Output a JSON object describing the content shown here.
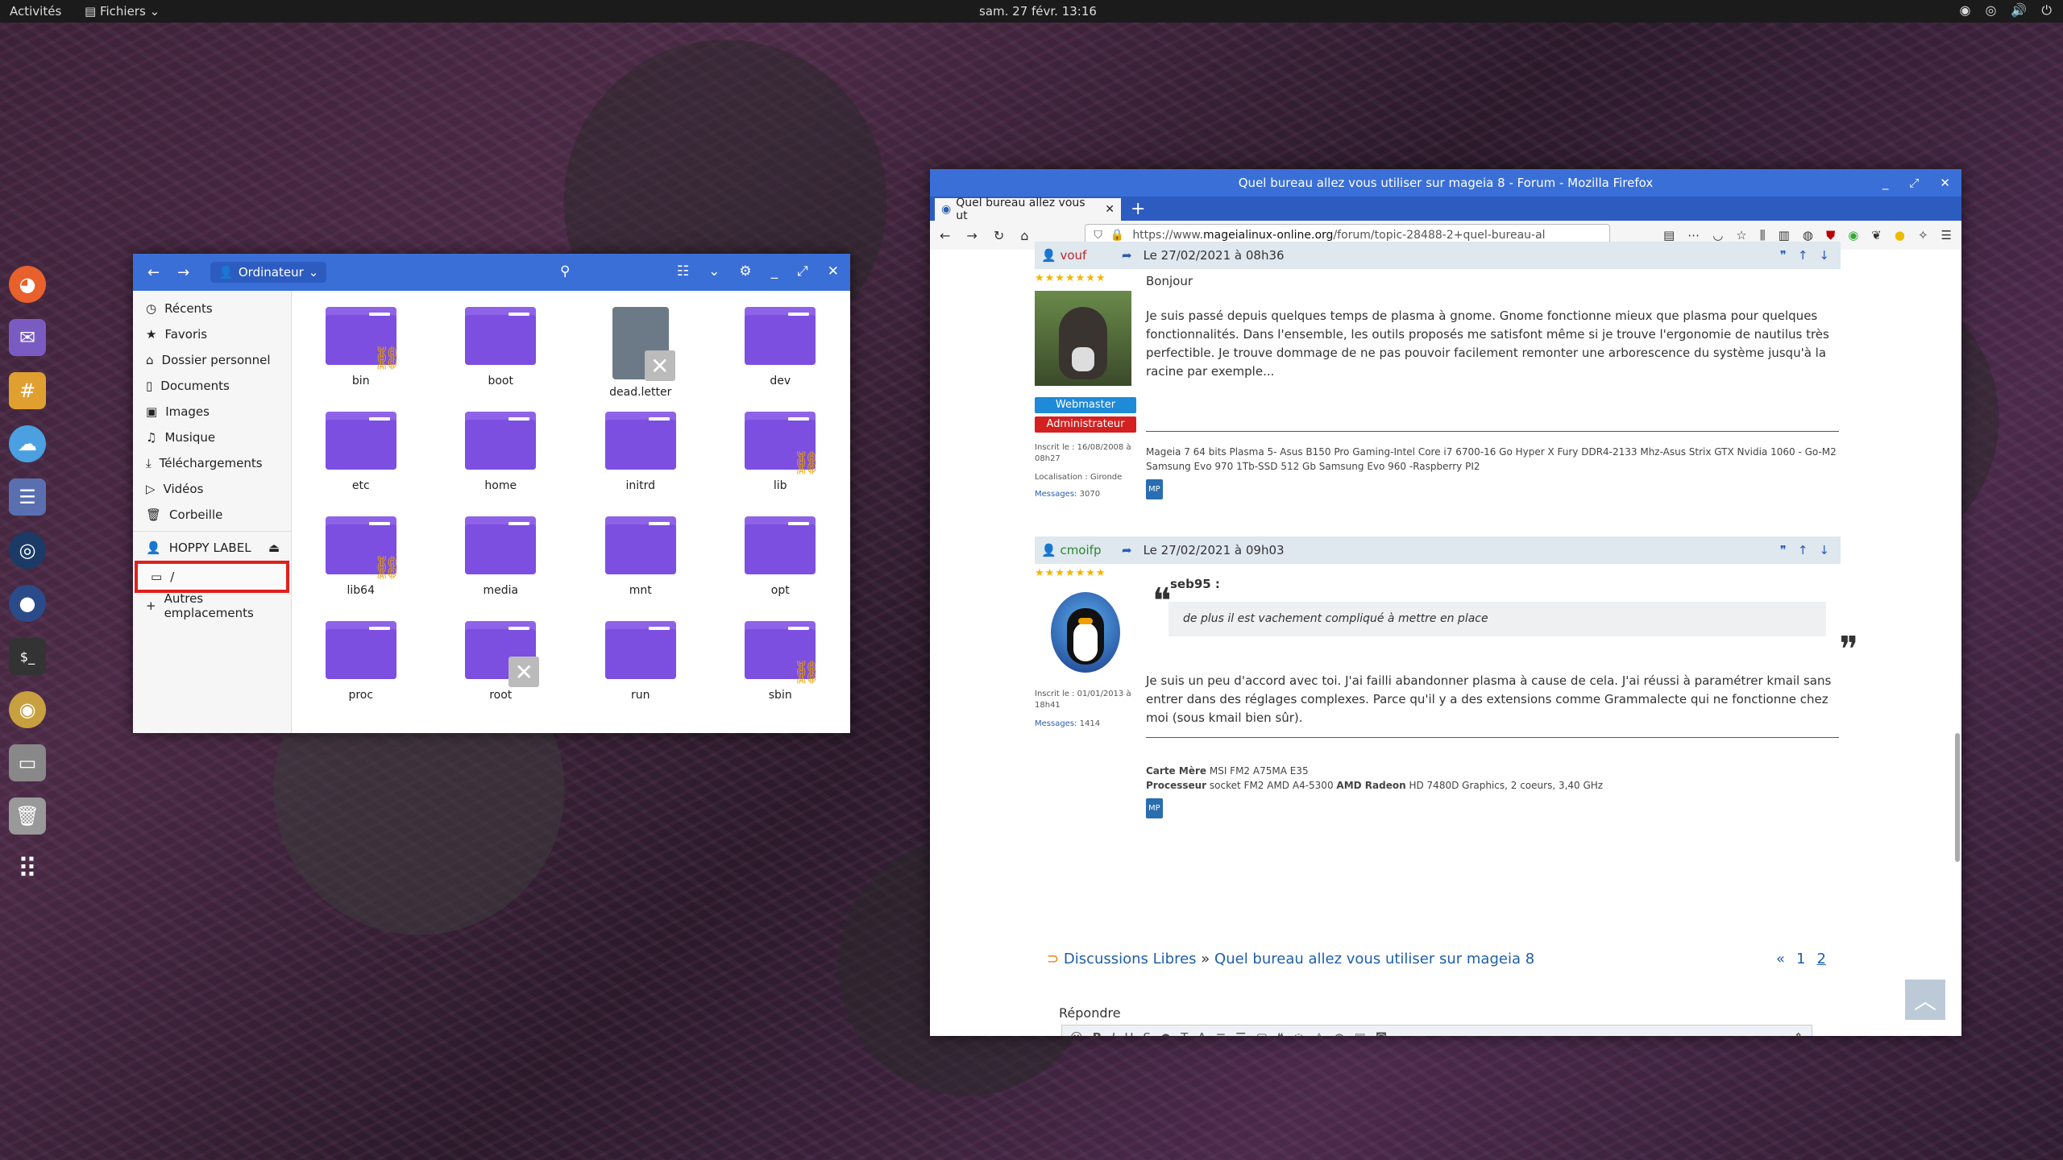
{
  "topbar": {
    "activities": "Activités",
    "app": "Fichiers",
    "clock": "sam. 27 févr.  13:16"
  },
  "files": {
    "location": "Ordinateur",
    "sidebar": [
      "Récents",
      "Favoris",
      "Dossier personnel",
      "Documents",
      "Images",
      "Musique",
      "Téléchargements",
      "Vidéos",
      "Corbeille"
    ],
    "device": "HOPPY LABEL",
    "selected": "/",
    "other": "Autres emplacements",
    "items": [
      {
        "name": "bin",
        "kind": "link"
      },
      {
        "name": "boot",
        "kind": "folder"
      },
      {
        "name": "dead.letter",
        "kind": "file"
      },
      {
        "name": "dev",
        "kind": "folder"
      },
      {
        "name": "etc",
        "kind": "folder"
      },
      {
        "name": "home",
        "kind": "folder"
      },
      {
        "name": "initrd",
        "kind": "folder"
      },
      {
        "name": "lib",
        "kind": "link"
      },
      {
        "name": "lib64",
        "kind": "link"
      },
      {
        "name": "media",
        "kind": "folder"
      },
      {
        "name": "mnt",
        "kind": "folder"
      },
      {
        "name": "opt",
        "kind": "folder"
      },
      {
        "name": "proc",
        "kind": "folder"
      },
      {
        "name": "root",
        "kind": "locked"
      },
      {
        "name": "run",
        "kind": "folder"
      },
      {
        "name": "sbin",
        "kind": "link"
      }
    ]
  },
  "firefox": {
    "title": "Quel bureau allez vous utiliser sur mageia 8 - Forum - Mozilla Firefox",
    "tab": "Quel bureau allez vous ut",
    "url_prefix": "https://www.",
    "url_host": "mageialinux-online.org",
    "url_path": "/forum/topic-28488-2+quel-bureau-al",
    "posts": [
      {
        "author": "vouf",
        "date": "Le 27/02/2021 à 08h36",
        "greeting": "Bonjour",
        "text": "Je suis passé depuis quelques temps de plasma à gnome. Gnome fonctionne mieux que plasma pour quelques fonctionnalités. Dans l'ensemble, les outils proposés me satisfont même si je trouve l'ergonomie de nautilus très perfectible. Je trouve dommage de ne pas pouvoir facilement remonter une arborescence du système jusqu'à la racine par exemple...",
        "rank1": "Webmaster",
        "rank2": "Administrateur",
        "joined": "Inscrit le : 16/08/2008 à 08h27",
        "location": "Localisation : Gironde",
        "messages_label": "Messages:",
        "messages": "3070",
        "sig": "Mageia 7 64 bits Plasma 5- Asus B150 Pro Gaming-Intel Core i7 6700-16 Go Hyper X Fury DDR4-2133 Mhz-Asus Strix GTX Nvidia 1060 - Go-M2 Samsung Evo 970 1Tb-SSD 512 Gb Samsung Evo 960 -Raspberry PI2",
        "mp": "MP"
      },
      {
        "author": "cmoifp",
        "date": "Le 27/02/2021 à 09h03",
        "quote_author": "seb95 :",
        "quote": "de plus il est vachement compliqué à mettre en place",
        "text": "Je suis un peu d'accord avec toi. J'ai failli abandonner plasma à cause de cela. J'ai réussi à paramétrer kmail sans entrer dans des réglages complexes. Parce qu'il y a des extensions comme Grammalecte qui ne fonctionne chez moi (sous kmail bien sûr).",
        "joined": "Inscrit le : 01/01/2013 à 18h41",
        "messages_label": "Messages:",
        "messages": "1414",
        "sig_board_label": "Carte Mère",
        "sig_board": "MSI FM2 A75MA E35",
        "sig_cpu_label": "Processeur",
        "sig_cpu": "socket FM2 AMD A4-5300",
        "sig_gpu_label": "AMD Radeon",
        "sig_gpu": "HD 7480D Graphics, 2 coeurs, 3,40 GHz",
        "mp": "MP"
      }
    ],
    "breadcrumb_1": "Discussions Libres",
    "breadcrumb_sep": "»",
    "breadcrumb_2": "Quel bureau allez vous utiliser sur mageia 8",
    "pagination": [
      "«",
      "1",
      "2"
    ],
    "reply_label": "Répondre"
  }
}
